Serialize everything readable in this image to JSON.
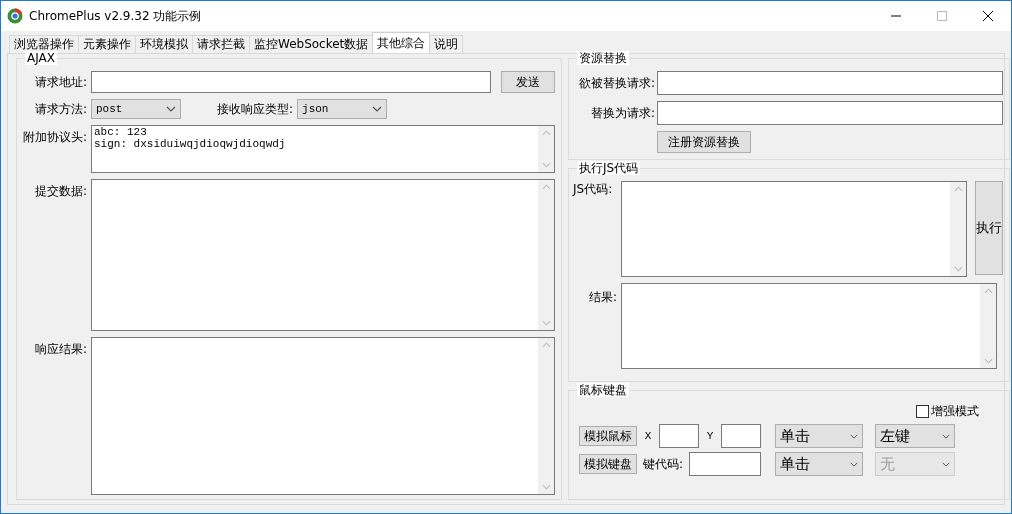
{
  "window": {
    "title": "ChromePlus v2.9.32 功能示例"
  },
  "tabs": [
    {
      "label": "浏览器操作",
      "selected": false
    },
    {
      "label": "元素操作",
      "selected": false
    },
    {
      "label": "环境模拟",
      "selected": false
    },
    {
      "label": "请求拦截",
      "selected": false
    },
    {
      "label": "监控WebSocket数据",
      "selected": false
    },
    {
      "label": "其他综合",
      "selected": true
    },
    {
      "label": "说明",
      "selected": false
    }
  ],
  "ajax": {
    "title": "AJAX",
    "url_label": "请求地址:",
    "send_button": "发送",
    "method_label": "请求方法:",
    "method_value": "post",
    "response_type_label": "接收响应类型:",
    "response_type_value": "json",
    "headers_label": "附加协议头:",
    "headers_lines": [
      "abc: 123",
      "sign: dxsiduiwqjdioqwjdioqwdj"
    ],
    "body_label": "提交数据:",
    "result_label": "响应结果:"
  },
  "resource_replace": {
    "title": "资源替换",
    "source_label": "欲被替换请求:",
    "target_label": "替换为请求:",
    "register_button": "注册资源替换"
  },
  "js": {
    "title": "执行JS代码",
    "code_label": "JS代码:",
    "run_button": "执行",
    "result_label": "结果:"
  },
  "mouse_keyboard": {
    "title": "鼠标键盘",
    "enhanced_mode": {
      "label": "增强模式",
      "checked": false
    },
    "mouse_button": "模拟鼠标",
    "x_label": "X",
    "y_label": "Y",
    "mouse_action": "单击",
    "mouse_key": "左键",
    "keyboard_button": "模拟键盘",
    "keycode_label": "键代码:",
    "key_action": "单击",
    "key_modifier": {
      "value": "无",
      "disabled": true
    }
  }
}
